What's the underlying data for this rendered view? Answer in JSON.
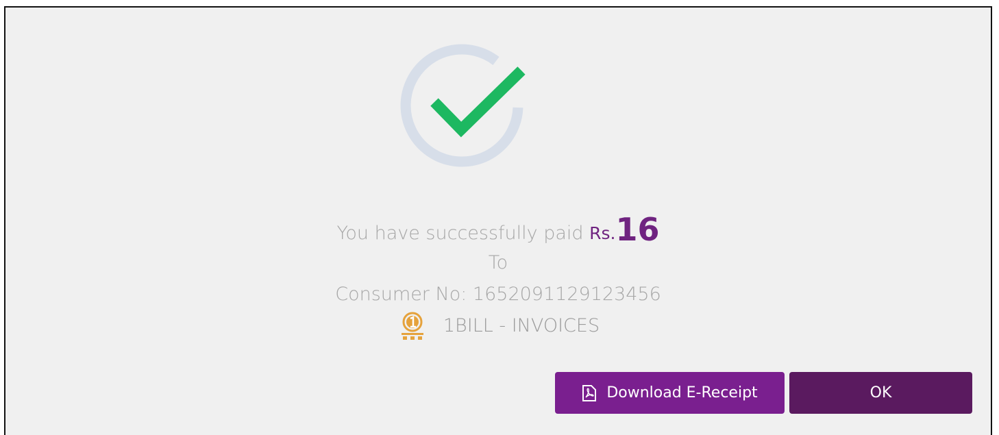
{
  "dialog": {
    "message": {
      "prefix": "You have successfully paid",
      "currency": "Rs.",
      "amount": "16",
      "to": "To",
      "consumer_label": "Consumer No:",
      "consumer_number": "1652091129123456"
    },
    "biller": {
      "name": "1BILL - INVOICES",
      "logo_icon": "1bill-logo-icon",
      "logo_color": "#e5a23c"
    },
    "status_icon": "success-check-icon",
    "actions": {
      "download_label": "Download E-Receipt",
      "ok_label": "OK"
    },
    "colors": {
      "primary": "#7a1f8f",
      "primary_dark": "#5a1a5f",
      "success": "#1db861",
      "ring": "#d7dee9",
      "amount": "#6f2380"
    }
  }
}
